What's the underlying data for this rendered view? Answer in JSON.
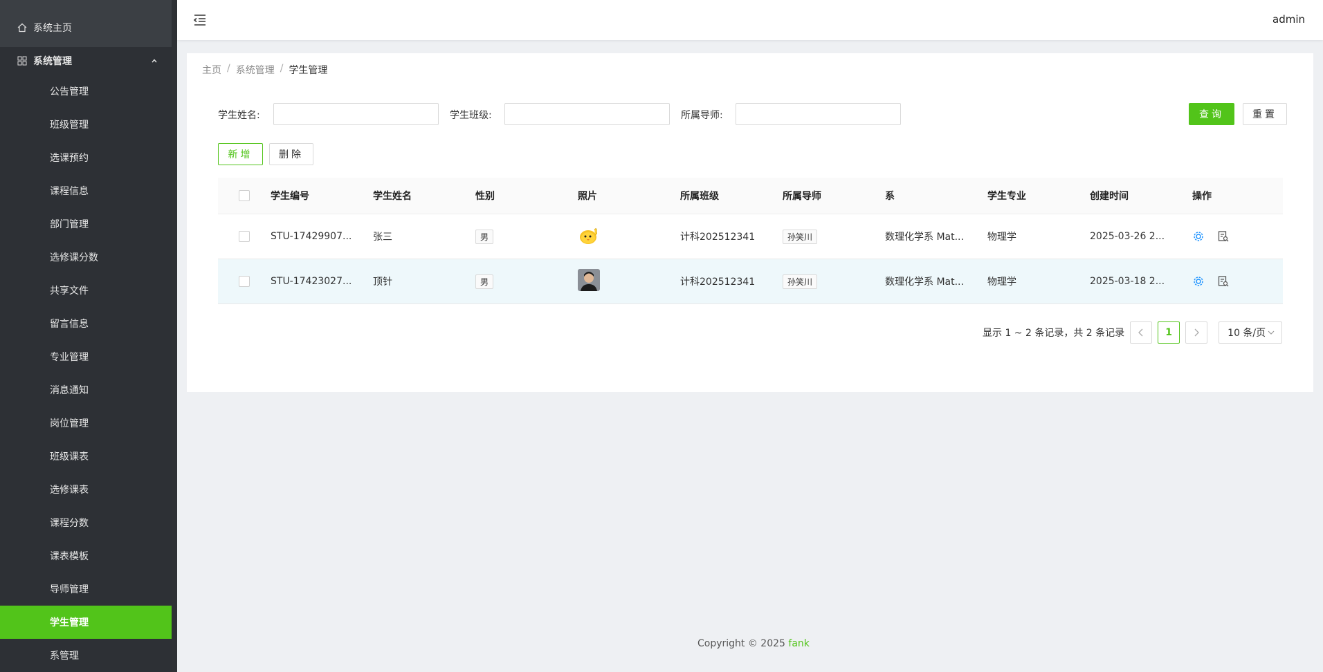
{
  "sidebar": {
    "home": "系统主页",
    "group": "系统管理",
    "items": [
      {
        "label": "公告管理"
      },
      {
        "label": "班级管理"
      },
      {
        "label": "选课预约"
      },
      {
        "label": "课程信息"
      },
      {
        "label": "部门管理"
      },
      {
        "label": "选修课分数"
      },
      {
        "label": "共享文件"
      },
      {
        "label": "留言信息"
      },
      {
        "label": "专业管理"
      },
      {
        "label": "消息通知"
      },
      {
        "label": "岗位管理"
      },
      {
        "label": "班级课表"
      },
      {
        "label": "选修课表"
      },
      {
        "label": "课程分数"
      },
      {
        "label": "课表模板"
      },
      {
        "label": "导师管理"
      },
      {
        "label": "学生管理",
        "active": true
      },
      {
        "label": "系管理"
      }
    ]
  },
  "header": {
    "user": "admin"
  },
  "breadcrumb": [
    "主页",
    "系统管理",
    "学生管理"
  ],
  "filters": {
    "name_label": "学生姓名:",
    "class_label": "学生班级:",
    "tutor_label": "所属导师:",
    "name_value": "",
    "class_value": "",
    "tutor_value": ""
  },
  "buttons": {
    "query": "查询",
    "reset": "重置",
    "add": "新增",
    "delete": "删除"
  },
  "table": {
    "headers": [
      "学生编号",
      "学生姓名",
      "性别",
      "照片",
      "所属班级",
      "所属导师",
      "系",
      "学生专业",
      "创建时间",
      "操作"
    ],
    "rows": [
      {
        "code": "STU-17429907...",
        "name": "张三",
        "sex": "男",
        "photo": "cartoon-chick-avatar",
        "cls": "计科202512341",
        "tutor": "孙笑川",
        "dept": "数理化学系 Mat...",
        "major": "物理学",
        "time": "2025-03-26 2..."
      },
      {
        "code": "STU-17423027...",
        "name": "顶针",
        "sex": "男",
        "photo": "portrait-avatar",
        "cls": "计科202512341",
        "tutor": "孙笑川",
        "dept": "数理化学系 Mat...",
        "major": "物理学",
        "time": "2025-03-18 2..."
      }
    ]
  },
  "pagination": {
    "summary": "显示 1 ~ 2 条记录，共 2 条记录",
    "current": "1",
    "page_size": "10 条/页"
  },
  "footer": {
    "text": "Copyright © 2025 ",
    "brand": "fank"
  },
  "colors": {
    "accent": "#52c41a",
    "sidebar": "#3b3f44",
    "link_icon": "#1890ff"
  }
}
